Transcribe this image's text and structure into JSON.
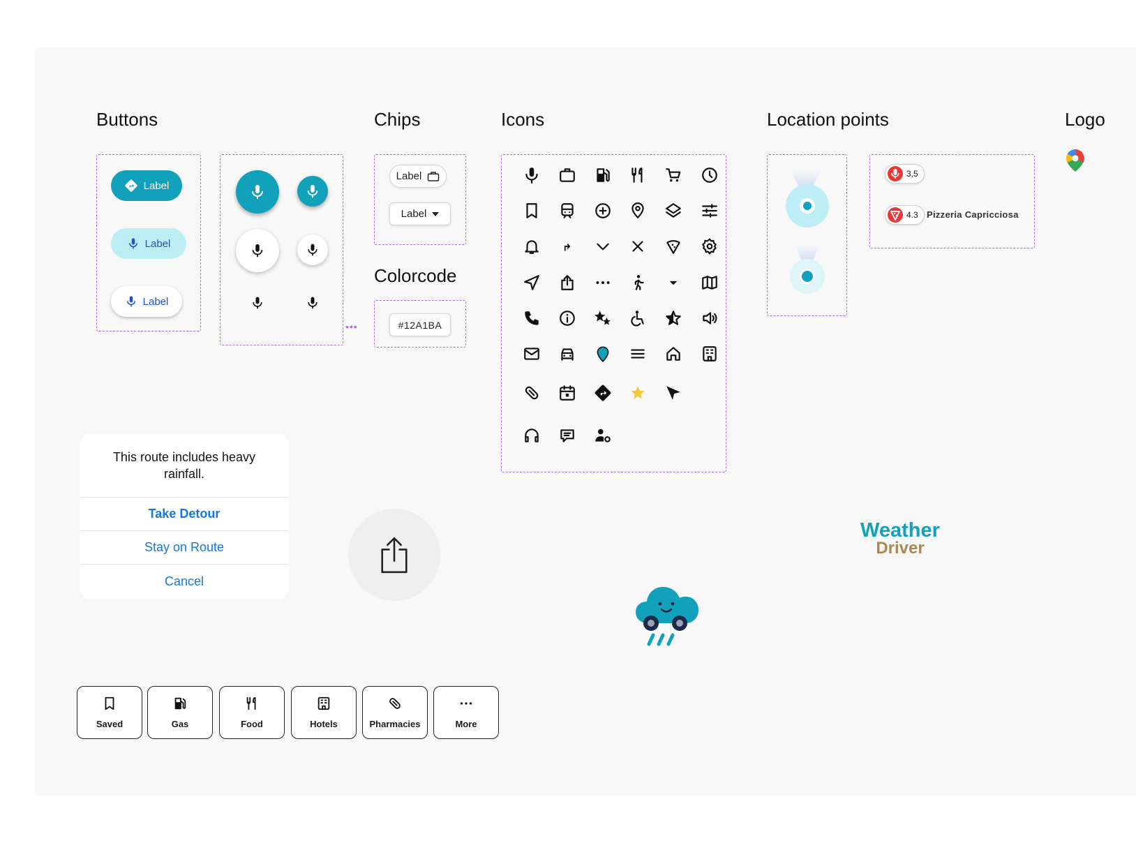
{
  "sections": {
    "buttons": "Buttons",
    "chips": "Chips",
    "icons": "Icons",
    "location_points": "Location points",
    "logo": "Logo",
    "colorcode": "Colorcode"
  },
  "buttons": {
    "filled_label": "Label",
    "tonal_label": "Label",
    "elevated_label": "Label"
  },
  "chips": {
    "chip1_label": "Label",
    "chip2_label": "Label"
  },
  "colorcode": {
    "value": "#12A1BA"
  },
  "icons": [
    "mic-icon",
    "briefcase-icon",
    "gas-station-icon",
    "restaurant-icon",
    "cart-icon",
    "clock-icon",
    "bookmark-icon",
    "train-icon",
    "add-circle-icon",
    "location-pin-icon",
    "layers-icon",
    "tune-icon",
    "bell-icon",
    "turn-right-icon",
    "chevron-down-icon",
    "close-icon",
    "pizza-icon",
    "gear-icon",
    "navigate-icon",
    "share-icon",
    "more-horizontal-icon",
    "walk-icon",
    "dropdown-arrow-icon",
    "map-icon",
    "phone-icon",
    "info-icon",
    "stars-icon",
    "accessible-icon",
    "star-outline-icon",
    "volume-icon",
    "mail-icon",
    "car-icon",
    "pin-filled-icon",
    "menu-icon",
    "home-icon",
    "hotel-icon",
    "pill-icon",
    "calendar-icon",
    "directions-icon",
    "star-filled-icon",
    "cursor-icon",
    "headset-icon",
    "chat-icon",
    "user-settings-icon"
  ],
  "location_points": {
    "poi1_rating": "3,5",
    "poi2_rating": "4.3",
    "poi2_name": "Pizzeria Capricciosa"
  },
  "dialog": {
    "message": "This route includes heavy rainfall.",
    "action1": "Take Detour",
    "action2": "Stay on Route",
    "action3": "Cancel"
  },
  "logo": {
    "word1": "Weather",
    "word2": "Driver"
  },
  "categories": [
    {
      "label": "Saved",
      "icon": "bookmark-icon"
    },
    {
      "label": "Gas",
      "icon": "gas-station-icon"
    },
    {
      "label": "Food",
      "icon": "restaurant-icon"
    },
    {
      "label": "Hotels",
      "icon": "hotel-icon"
    },
    {
      "label": "Pharmacies",
      "icon": "pill-icon"
    },
    {
      "label": "More",
      "icon": "more-horizontal-icon"
    }
  ],
  "colors": {
    "accent": "#12A1BA",
    "tonal": "#bdeef5",
    "link_blue": "#1677e0",
    "dash": "#a66cf0",
    "logo_gold": "#a8894f",
    "star_yellow": "#f5c842"
  }
}
